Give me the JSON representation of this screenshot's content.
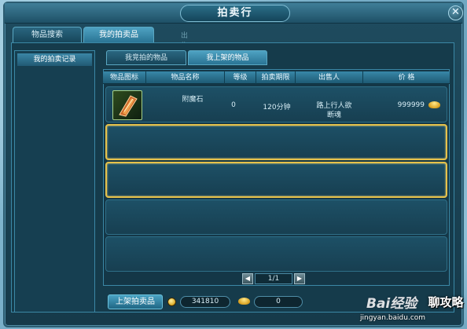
{
  "window": {
    "title": "拍卖行",
    "close_symbol": "✕"
  },
  "main_tabs": [
    {
      "label": "物品搜索",
      "active": false
    },
    {
      "label": "我的拍卖品",
      "active": true
    },
    {
      "label": "出售记录",
      "active": false
    }
  ],
  "sidebar": {
    "items": [
      {
        "label": "我的拍卖记录",
        "active": true
      }
    ]
  },
  "sub_tabs": [
    {
      "label": "我竞拍的物品",
      "active": false
    },
    {
      "label": "我上架的物品",
      "active": true
    }
  ],
  "table": {
    "columns": [
      "物品图标",
      "物品名称",
      "等级",
      "拍卖期限",
      "出售人",
      "价 格"
    ],
    "rows": [
      {
        "icon": "enchant-stone-icon",
        "name": "附魔石",
        "level": "0",
        "duration": "120分钟",
        "seller_line1": "路上行人欲",
        "seller_line2": "断魂",
        "price": "999999",
        "currency_icon": "gold-ingot-icon"
      }
    ]
  },
  "pager": {
    "prev_symbol": "◀",
    "next_symbol": "▶",
    "page_text": "1/1"
  },
  "footer": {
    "list_button_label": "上架拍卖品",
    "coin_balance": "341810",
    "ingot_balance": "0"
  },
  "watermark": {
    "logo_text": "Bai经验",
    "site_text": "jingyan.baidu.com",
    "corner_text": "聊攻略"
  },
  "colors": {
    "frame": "#163a4a",
    "tab_active": "#2a7494",
    "selected_border": "#e6c24a",
    "header": "#1e5a74"
  }
}
